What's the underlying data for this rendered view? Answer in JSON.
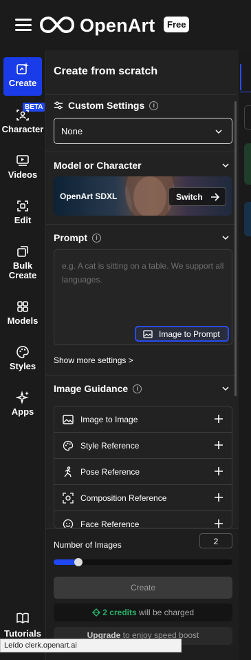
{
  "brand": {
    "name": "OpenArt",
    "badge": "Free"
  },
  "nav": {
    "items": [
      {
        "label": "Create",
        "icon": "sparkle-edit-icon",
        "active": true
      },
      {
        "label": "Character",
        "icon": "face-scan-icon",
        "badge": "BETA"
      },
      {
        "label": "Videos",
        "icon": "video-play-icon"
      },
      {
        "label": "Edit",
        "icon": "edit-frame-icon"
      },
      {
        "label": "Bulk Create",
        "icon": "stack-icon"
      },
      {
        "label": "Models",
        "icon": "grid-icon"
      },
      {
        "label": "Styles",
        "icon": "palette-icon"
      },
      {
        "label": "Apps",
        "icon": "sparkles-icon"
      },
      {
        "label": "Tutorials",
        "icon": "book-icon"
      }
    ]
  },
  "panel": {
    "title": "Create from scratch",
    "custom_settings": {
      "heading": "Custom Settings",
      "value": "None"
    },
    "model": {
      "heading": "Model or Character",
      "name": "OpenArt SDXL",
      "switch_label": "Switch"
    },
    "prompt": {
      "heading": "Prompt",
      "placeholder": "e.g. A cat is sitting on a table. We support all languages.",
      "image_to_prompt": "Image to Prompt"
    },
    "show_more": "Show more settings >",
    "guidance": {
      "heading": "Image Guidance",
      "items": [
        "Image to Image",
        "Style Reference",
        "Pose Reference",
        "Composition Reference",
        "Face Reference"
      ]
    }
  },
  "bottom": {
    "num_label": "Number of Images",
    "num_value": "2",
    "slider_fraction": 0.14,
    "create_label": "Create",
    "credits_amount": "2 credits",
    "credits_suffix": " will be charged",
    "upgrade_link": "Upgrade",
    "upgrade_suffix": " to enjoy speed boost"
  },
  "status_bar": "Leído clerk.openart.ai",
  "colors": {
    "accent": "#1a3ce8",
    "credits": "#28b26a"
  }
}
